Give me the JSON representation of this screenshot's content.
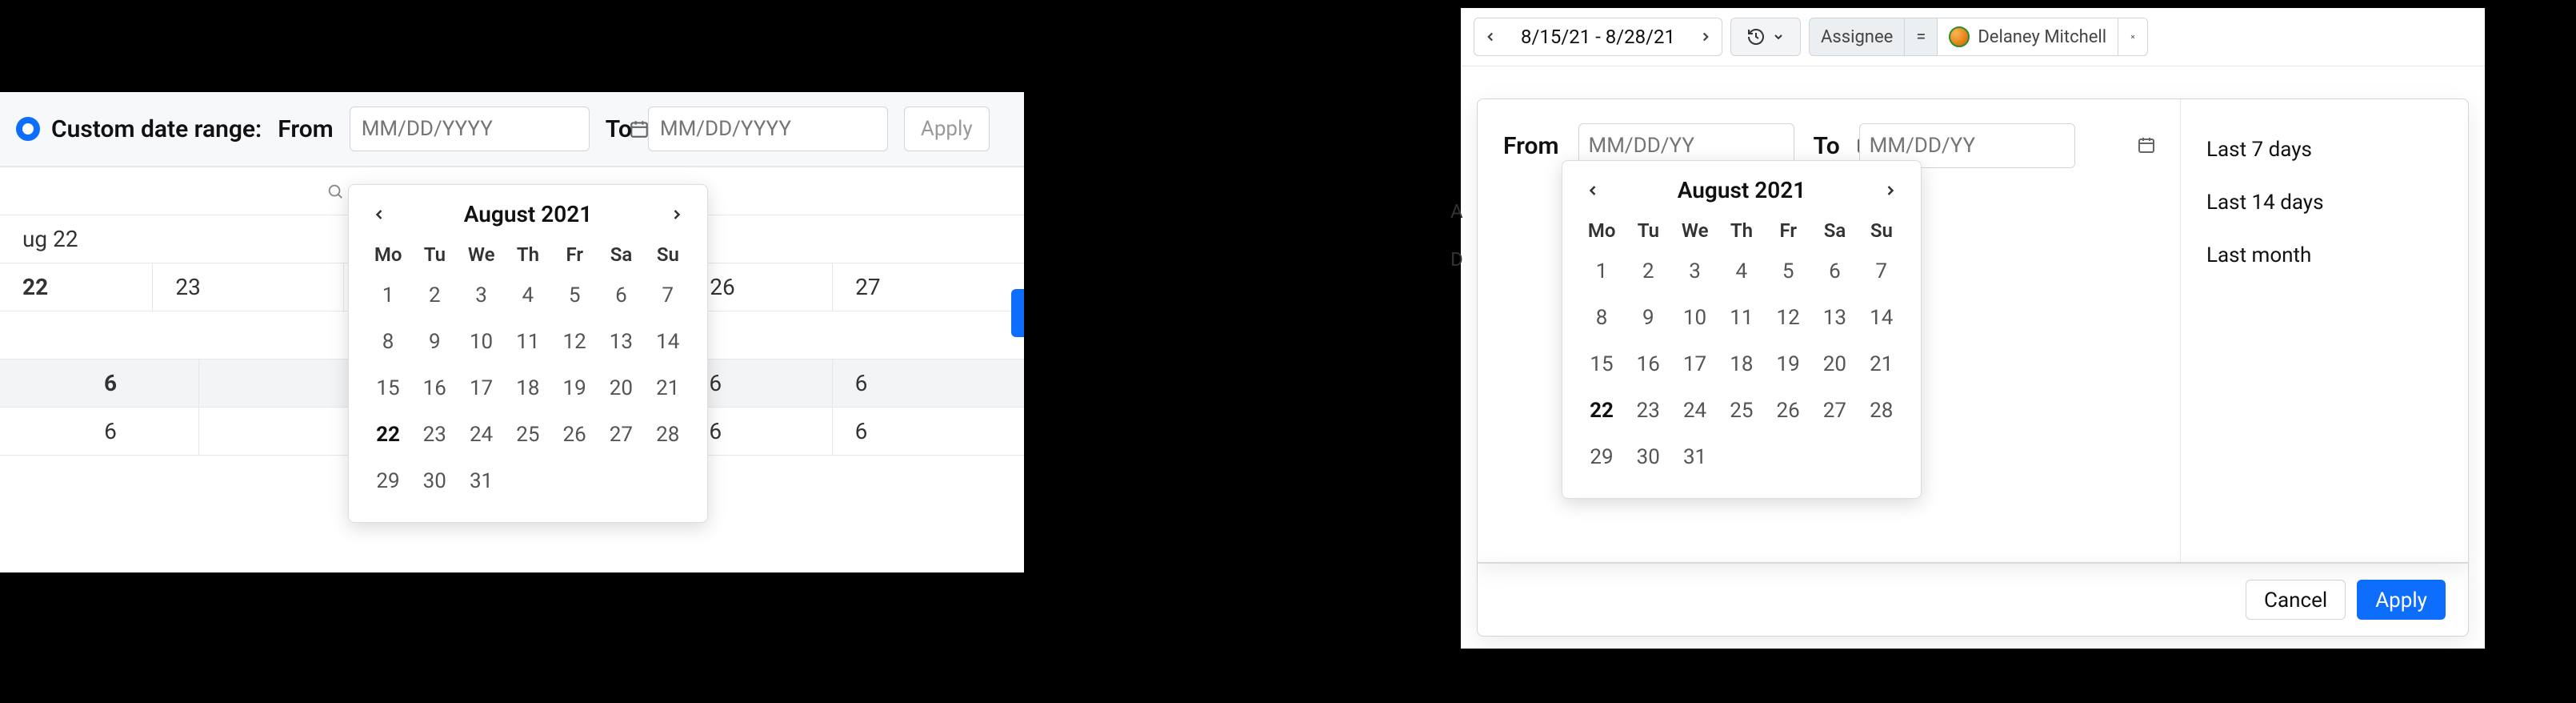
{
  "left": {
    "radio_label": "Custom date range:",
    "from_label": "From",
    "to_label": "To",
    "date_placeholder": "MM/DD/YYYY",
    "apply_label": "Apply",
    "bg_row1_label": "ug 22",
    "bg_row2": [
      "22",
      "23",
      "26",
      "27"
    ],
    "bg_row3": [
      "6",
      "6",
      "6"
    ],
    "bg_row4": [
      "6",
      "6",
      "6"
    ]
  },
  "calendar": {
    "title": "August 2021",
    "dow": [
      "Mo",
      "Tu",
      "We",
      "Th",
      "Fr",
      "Sa",
      "Su"
    ],
    "weeks": [
      [
        "1",
        "2",
        "3",
        "4",
        "5",
        "6",
        "7"
      ],
      [
        "8",
        "9",
        "10",
        "11",
        "12",
        "13",
        "14"
      ],
      [
        "15",
        "16",
        "17",
        "18",
        "19",
        "20",
        "21"
      ],
      [
        "22",
        "23",
        "24",
        "25",
        "26",
        "27",
        "28"
      ],
      [
        "29",
        "30",
        "31",
        "",
        "",
        "",
        ""
      ]
    ],
    "bold_day": "22"
  },
  "right": {
    "range_label": "8/15/21 - 8/28/21",
    "filter": {
      "field": "Assignee",
      "op": "=",
      "value": "Delaney Mitchell"
    },
    "from_label": "From",
    "to_label": "To",
    "date_placeholder": "MM/DD/YY",
    "presets": [
      "Last 7 days",
      "Last 14 days",
      "Last month"
    ],
    "cancel_label": "Cancel",
    "apply_label": "Apply",
    "side_letters": [
      "A",
      "D"
    ]
  }
}
